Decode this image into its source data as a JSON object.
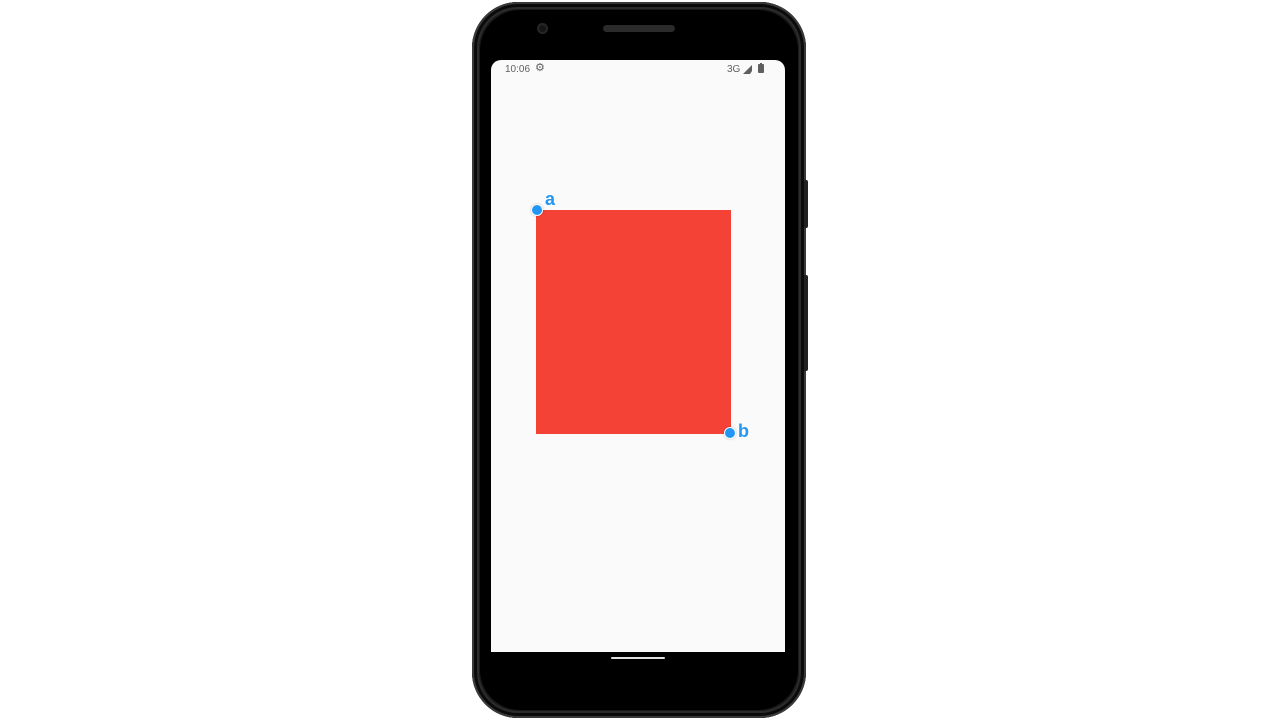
{
  "status_bar": {
    "time": "10:06",
    "network": "3G",
    "icons": [
      "settings-gear-icon",
      "signal-icon",
      "battery-icon"
    ],
    "text_color": "#5f5f5f"
  },
  "canvas": {
    "background": "#fafafa",
    "shape_color": "#f44336",
    "handle_color": "#2196f3",
    "handles": [
      {
        "label": "a"
      },
      {
        "label": "b"
      }
    ]
  },
  "device": {
    "frame_color": "#1a1a1a",
    "nav": "home-pill-icon"
  }
}
